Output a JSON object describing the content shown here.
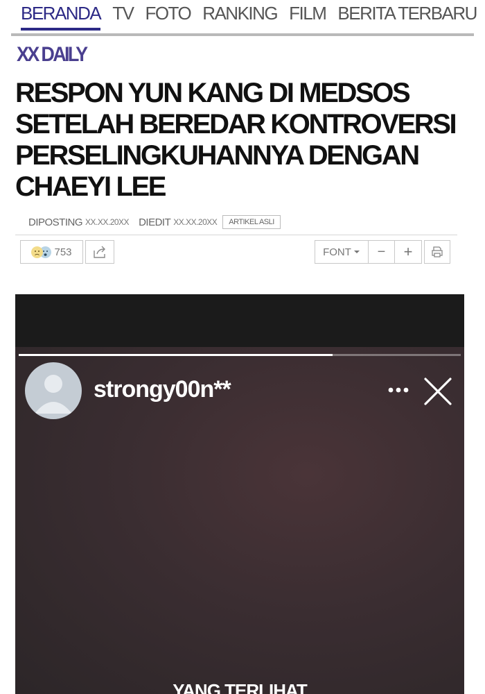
{
  "nav": {
    "items": [
      "BERANDA",
      "TV",
      "FOTO",
      "RANKING",
      "FILM",
      "BERITA TERBARU"
    ],
    "active": "BERANDA"
  },
  "brand": "XX DAILY",
  "article": {
    "title_lines": [
      "RESPON YUN KANG DI MEDSOS",
      "SETELAH BEREDAR KONTROVERSI",
      "PERSELINGKUHANNYA DENGAN",
      "CHAEYI LEE"
    ],
    "posted_label": "DIPOSTING",
    "posted_date": "XX.XX.20XX",
    "edited_label": "DIEDIT",
    "edited_date": "XX.XX.20XX",
    "badge": "ARTIKEL ASLI"
  },
  "toolbar": {
    "reaction_count": "753",
    "font_label": "FONT",
    "minus": "−",
    "plus": "+"
  },
  "story": {
    "username": "strongy00n**",
    "progress": 0.71,
    "caption": "YANG TERLIHAT"
  },
  "colors": {
    "accent": "#2d2a86",
    "brand": "#4a3f8f"
  }
}
